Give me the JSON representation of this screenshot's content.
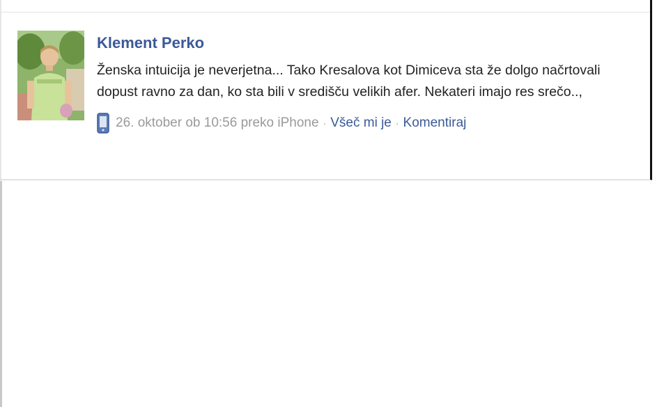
{
  "post": {
    "author": "Klement Perko",
    "message": "Ženska intuicija je neverjetna... Tako Kresalova kot Dimiceva sta že dolgo načrtovali dopust ravno za dan, ko sta bili v središču velikih afer. Nekateri imajo res srečo..,",
    "timestamp": "26. oktober ob 10:56 preko iPhone",
    "like_label": "Všeč mi je",
    "comment_label": "Komentiraj",
    "separator": "·"
  },
  "icons": {
    "device": "mobile-phone-icon"
  },
  "colors": {
    "link": "#3b5998",
    "meta_text": "#999999",
    "body_text": "#222222"
  }
}
